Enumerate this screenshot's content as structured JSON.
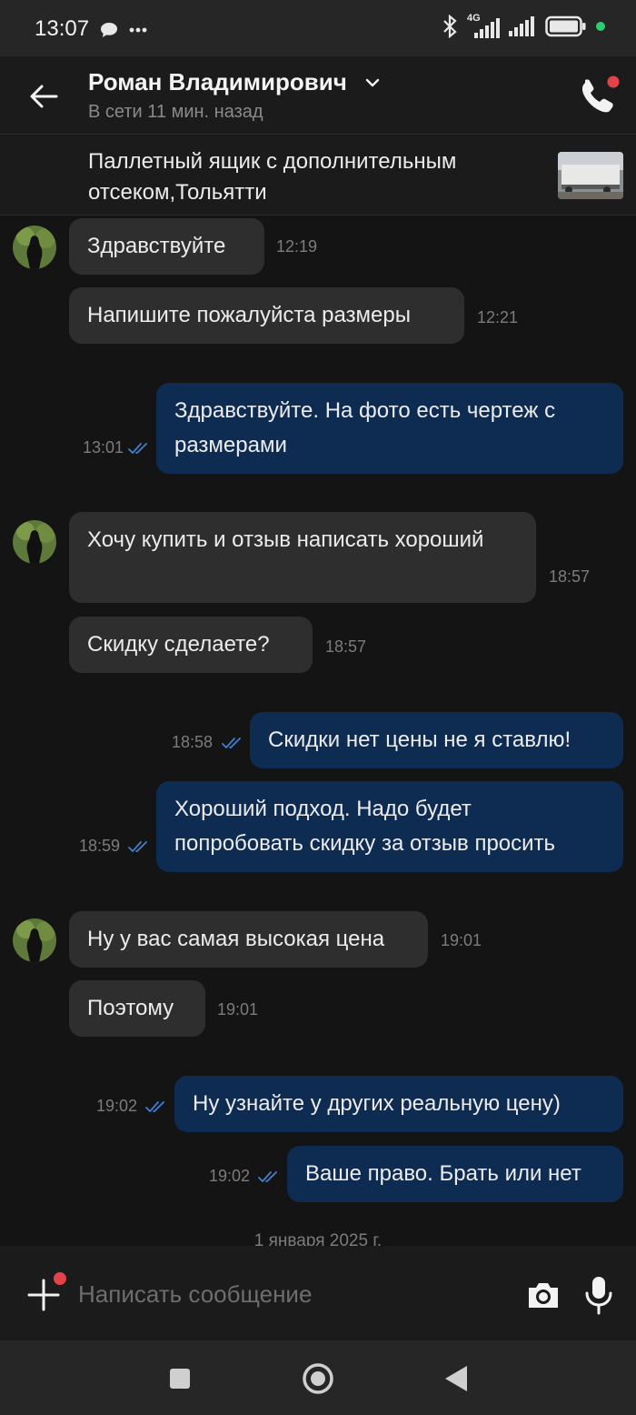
{
  "status_bar": {
    "time": "13:07",
    "network": "4G"
  },
  "header": {
    "contact_name": "Роман Владимирович",
    "presence": "В сети 11 мин. назад"
  },
  "listing": {
    "title": "Паллетный ящик с дополнительным отсеком,Тольятти"
  },
  "messages": [
    {
      "text": "Здравствуйте",
      "time": "12:19"
    },
    {
      "text": "Напишите пожалуйста размеры",
      "time": "12:21"
    },
    {
      "text": "Здравствуйте. На фото есть чертеж с размерами",
      "time": "13:01"
    },
    {
      "text": "Хочу купить и отзыв написать хороший",
      "time": "18:57"
    },
    {
      "text": "Скидку сделаете?",
      "time": "18:57"
    },
    {
      "text": "Скидки нет цены не я ставлю!",
      "time": "18:58"
    },
    {
      "text": "Хороший подход. Надо будет попробовать скидку за отзыв просить",
      "time": "18:59"
    },
    {
      "text": "Ну у вас самая высокая цена",
      "time": "19:01"
    },
    {
      "text": "Поэтому",
      "time": "19:01"
    },
    {
      "text": "Ну узнайте у других реальную цену)",
      "time": "19:02"
    },
    {
      "text": "Ваше право. Брать или нет",
      "time": "19:02"
    }
  ],
  "date_separator": "1 января 2025 г.",
  "composer": {
    "placeholder": "Написать сообщение"
  },
  "colors": {
    "incoming_bubble": "#2e2e2e",
    "outgoing_bubble": "#0e2b52",
    "read_ticks": "#3f7fd4",
    "notification_dot": "#e2434b",
    "online_dot": "#2ecc71"
  },
  "icons": {
    "back": "arrow-left-icon",
    "call": "phone-icon",
    "attach": "plus-icon",
    "camera": "camera-icon",
    "mic": "microphone-icon"
  }
}
